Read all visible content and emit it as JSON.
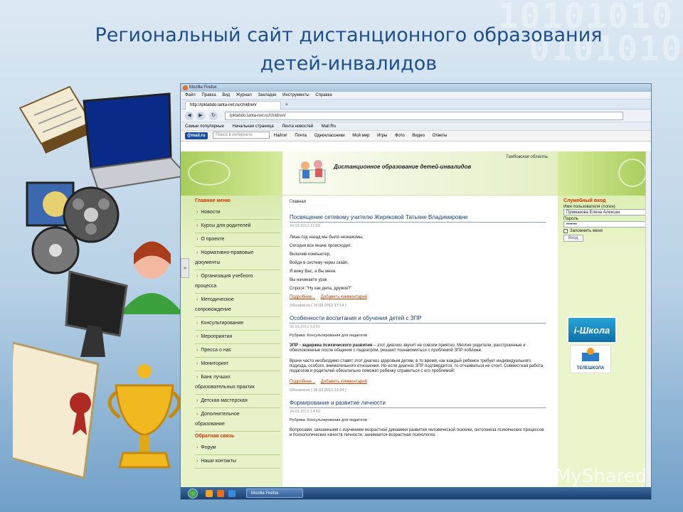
{
  "slide": {
    "title_line1": "Региональный сайт дистанционного образования",
    "title_line2": "детей-инвалидов",
    "binary_row1": "10101010",
    "binary_row2": "0101010",
    "watermark": "MyShared"
  },
  "browser": {
    "window_title": "Mozilla Firefox",
    "menu": [
      "Файл",
      "Правка",
      "Вид",
      "Журнал",
      "Закладки",
      "Инструменты",
      "Справка"
    ],
    "tab_label": "http://ipklabdo.lanta-net.ru/children/",
    "new_tab": "+",
    "url": "ipklabdo.lanta-net.ru/children/",
    "bookmarks": [
      "Самые популярные",
      "Начальная страница",
      "Лента новостей",
      "Mail.Ru"
    ],
    "mailbar": {
      "logo": "@mail.ru",
      "search_placeholder": "Поиск в интернете",
      "find": "Найти!",
      "links": [
        "Почта",
        "Одноклассники",
        "Мой мир",
        "Игры",
        "Фото",
        "Видео",
        "Ответы"
      ]
    }
  },
  "site": {
    "region": "Тамбовская область",
    "site_title": "Дистанционное образование детей-инвалидов",
    "collapse_icon": "»",
    "nav": {
      "main_heading": "Главное меню",
      "items": [
        {
          "label": "Новости",
          "arrow": true
        },
        {
          "label": "Курсы для родителей",
          "arrow": true
        },
        {
          "label": "О проекте",
          "arrow": true
        },
        {
          "label": "Нормативно-правовые",
          "arrow": true
        },
        {
          "label": "документы",
          "arrow": false
        },
        {
          "label": "Организация учебного",
          "arrow": true
        },
        {
          "label": "процесса",
          "arrow": false
        },
        {
          "label": "Методическое",
          "arrow": true
        },
        {
          "label": "сопровождение",
          "arrow": false
        },
        {
          "label": "Консультирование",
          "arrow": true
        },
        {
          "label": "Мероприятия",
          "arrow": true
        },
        {
          "label": "Пресса о нас",
          "arrow": true
        },
        {
          "label": "Мониторинг",
          "arrow": true
        },
        {
          "label": "Банк лучших",
          "arrow": true
        },
        {
          "label": "образовательных практик",
          "arrow": false
        },
        {
          "label": "Детская мастерская",
          "arrow": true
        },
        {
          "label": "Дополнительное",
          "arrow": true
        },
        {
          "label": "образование",
          "arrow": false
        }
      ],
      "feedback_heading": "Обратная связь",
      "feedback_items": [
        "Форум",
        "Наши контакты"
      ]
    },
    "breadcrumb": "Главная",
    "posts": [
      {
        "title": "Посвящение сетевому учителю Жиряковой Татьяне Владимировне",
        "date": "24.02.2012 17:00",
        "lines": [
          "Лишь год назад мы были незнакомы,",
          "Сегодня все иначе происходит.",
          "Включив компьютер,",
          "Войдя в систему через скайп,",
          "Я вижу Вас, а Вы меня.",
          "Вы начинаете урок",
          "Спрося: \"Ну как дела, дружок?\""
        ],
        "more": "Подробнее...",
        "comment": "Добавить комментарий",
        "updated": "Обновлено ( 25.02.2012 17:14 )"
      },
      {
        "title": "Особенности воспитания и обучения детей с ЗПР",
        "date": "06.02.2012 13:01",
        "rubric": "Рубрика: Консультирование для педагогов",
        "para1_bold": "ЗПР - задержка психического развития",
        "para1": " – этот диагноз звучит не совсем приятно. Многие родители, расстроенные и обеспокоенные после общения с педиатром, решают познакомиться с проблемой ЗПР поближе.",
        "para2": "Врачи часто необходимо ставят этот диагноз здоровым детям, в то время, как каждый ребенок требует индивидуального подхода, особого, внимательного отношения. Но если диагноз ЗПР подтвердится, то отчаиваться не стоит. Совместная работа педагогов и родителей обязательно поможет ребенку справиться с его проблемой!",
        "more": "Подробнее...",
        "comment": "Добавить комментарий",
        "updated": "Обновлено ( 06.02.2012 13:24 )"
      },
      {
        "title": "Формирование и развитие личности",
        "date": "24.01.2012 14:59",
        "rubric": "Рубрика: Консультирование для педагогов",
        "para1": "Вопросами, связанными с изучением возрастной динамики развития человеческой психики, онтогенеза психических процессов и психологических качеств личности, занимается возрастная психология."
      }
    ],
    "login": {
      "heading": "Служебный вход",
      "user_label": "Имя пользователя (логин)",
      "user_value": "Примакова Елена Алексан",
      "pass_label": "Пароль",
      "pass_value": "•••••••",
      "remember": "Запомнить меня",
      "submit": "Вход"
    },
    "banner1": "i-Школа",
    "banner2": "ТЕЛЕШКОЛА"
  },
  "taskbar": {
    "task_label": "Mozilla Firefox"
  }
}
